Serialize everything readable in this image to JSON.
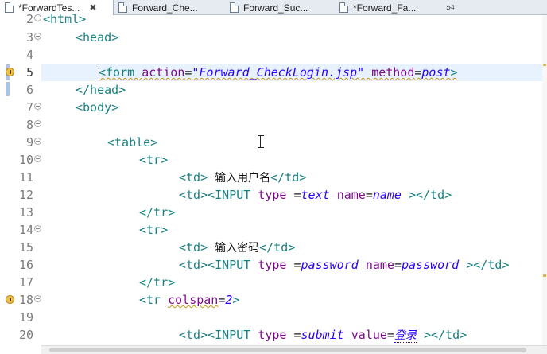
{
  "tabs": [
    {
      "label": "*ForwardTes...",
      "active": true,
      "closable": true
    },
    {
      "label": "Forward_Che...",
      "active": false,
      "closable": false
    },
    {
      "label": "Forward_Suc...",
      "active": false,
      "closable": false
    },
    {
      "label": "*Forward_Fa...",
      "active": false,
      "closable": false
    }
  ],
  "tab_overflow": {
    "symbol": "»",
    "count": "4"
  },
  "close_symbol": "✖",
  "editor": {
    "lines": [
      {
        "num": "2",
        "fold": true
      },
      {
        "num": "3",
        "fold": true
      },
      {
        "num": "4"
      },
      {
        "num": "5",
        "warning": true,
        "current": true
      },
      {
        "num": "6"
      },
      {
        "num": "7",
        "fold": true
      },
      {
        "num": "8",
        "fold": true
      },
      {
        "num": "9",
        "fold": true
      },
      {
        "num": "10",
        "fold": true
      },
      {
        "num": "11"
      },
      {
        "num": "12"
      },
      {
        "num": "13"
      },
      {
        "num": "14",
        "fold": true
      },
      {
        "num": "15"
      },
      {
        "num": "16"
      },
      {
        "num": "17"
      },
      {
        "num": "18",
        "fold": true,
        "warning": true
      },
      {
        "num": "19"
      },
      {
        "num": "20"
      }
    ],
    "code": {
      "l2_tag": "<html>",
      "l3_tag": "<head>",
      "l5_open": "<form ",
      "l5_attr1": "action",
      "l5_eq1": "=",
      "l5_val1": "\"Forward_CheckLogin.jsp\"",
      "l5_attr2": "method",
      "l5_eq2": "=",
      "l5_val2": "post",
      "l5_close": ">",
      "l6_tag": "</head>",
      "l7_tag": "<body>",
      "l9_tag": "<table>",
      "l10_tag": "<tr>",
      "l11_open": "<td>",
      "l11_text": "输入用户名",
      "l11_close": "</td>",
      "l12_open": "<td><INPUT ",
      "l12_attr1": "type",
      "l12_eq1": " =",
      "l12_val1": "text",
      "l12_attr2": "name",
      "l12_eq2": "=",
      "l12_val2": "name",
      "l12_close": " ></td>",
      "l13_tag": "</tr>",
      "l14_tag": "<tr>",
      "l15_open": "<td>",
      "l15_text": "输入密码",
      "l15_close": "</td>",
      "l16_open": "<td><INPUT ",
      "l16_attr1": "type",
      "l16_eq1": " =",
      "l16_val1": "password",
      "l16_attr2": "name",
      "l16_eq2": "=",
      "l16_val2": "password",
      "l16_close": " ></td>",
      "l17_tag": "</tr>",
      "l18_open": "<tr ",
      "l18_attr": "colspan",
      "l18_eq": "=",
      "l18_val": "2",
      "l18_close": ">",
      "l20_open": "<td><INPUT ",
      "l20_attr1": "type",
      "l20_eq1": " =",
      "l20_val1": "submit",
      "l20_attr2": "value",
      "l20_eq2": "=",
      "l20_val2": "登录",
      "l20_close": " ></td>"
    }
  }
}
